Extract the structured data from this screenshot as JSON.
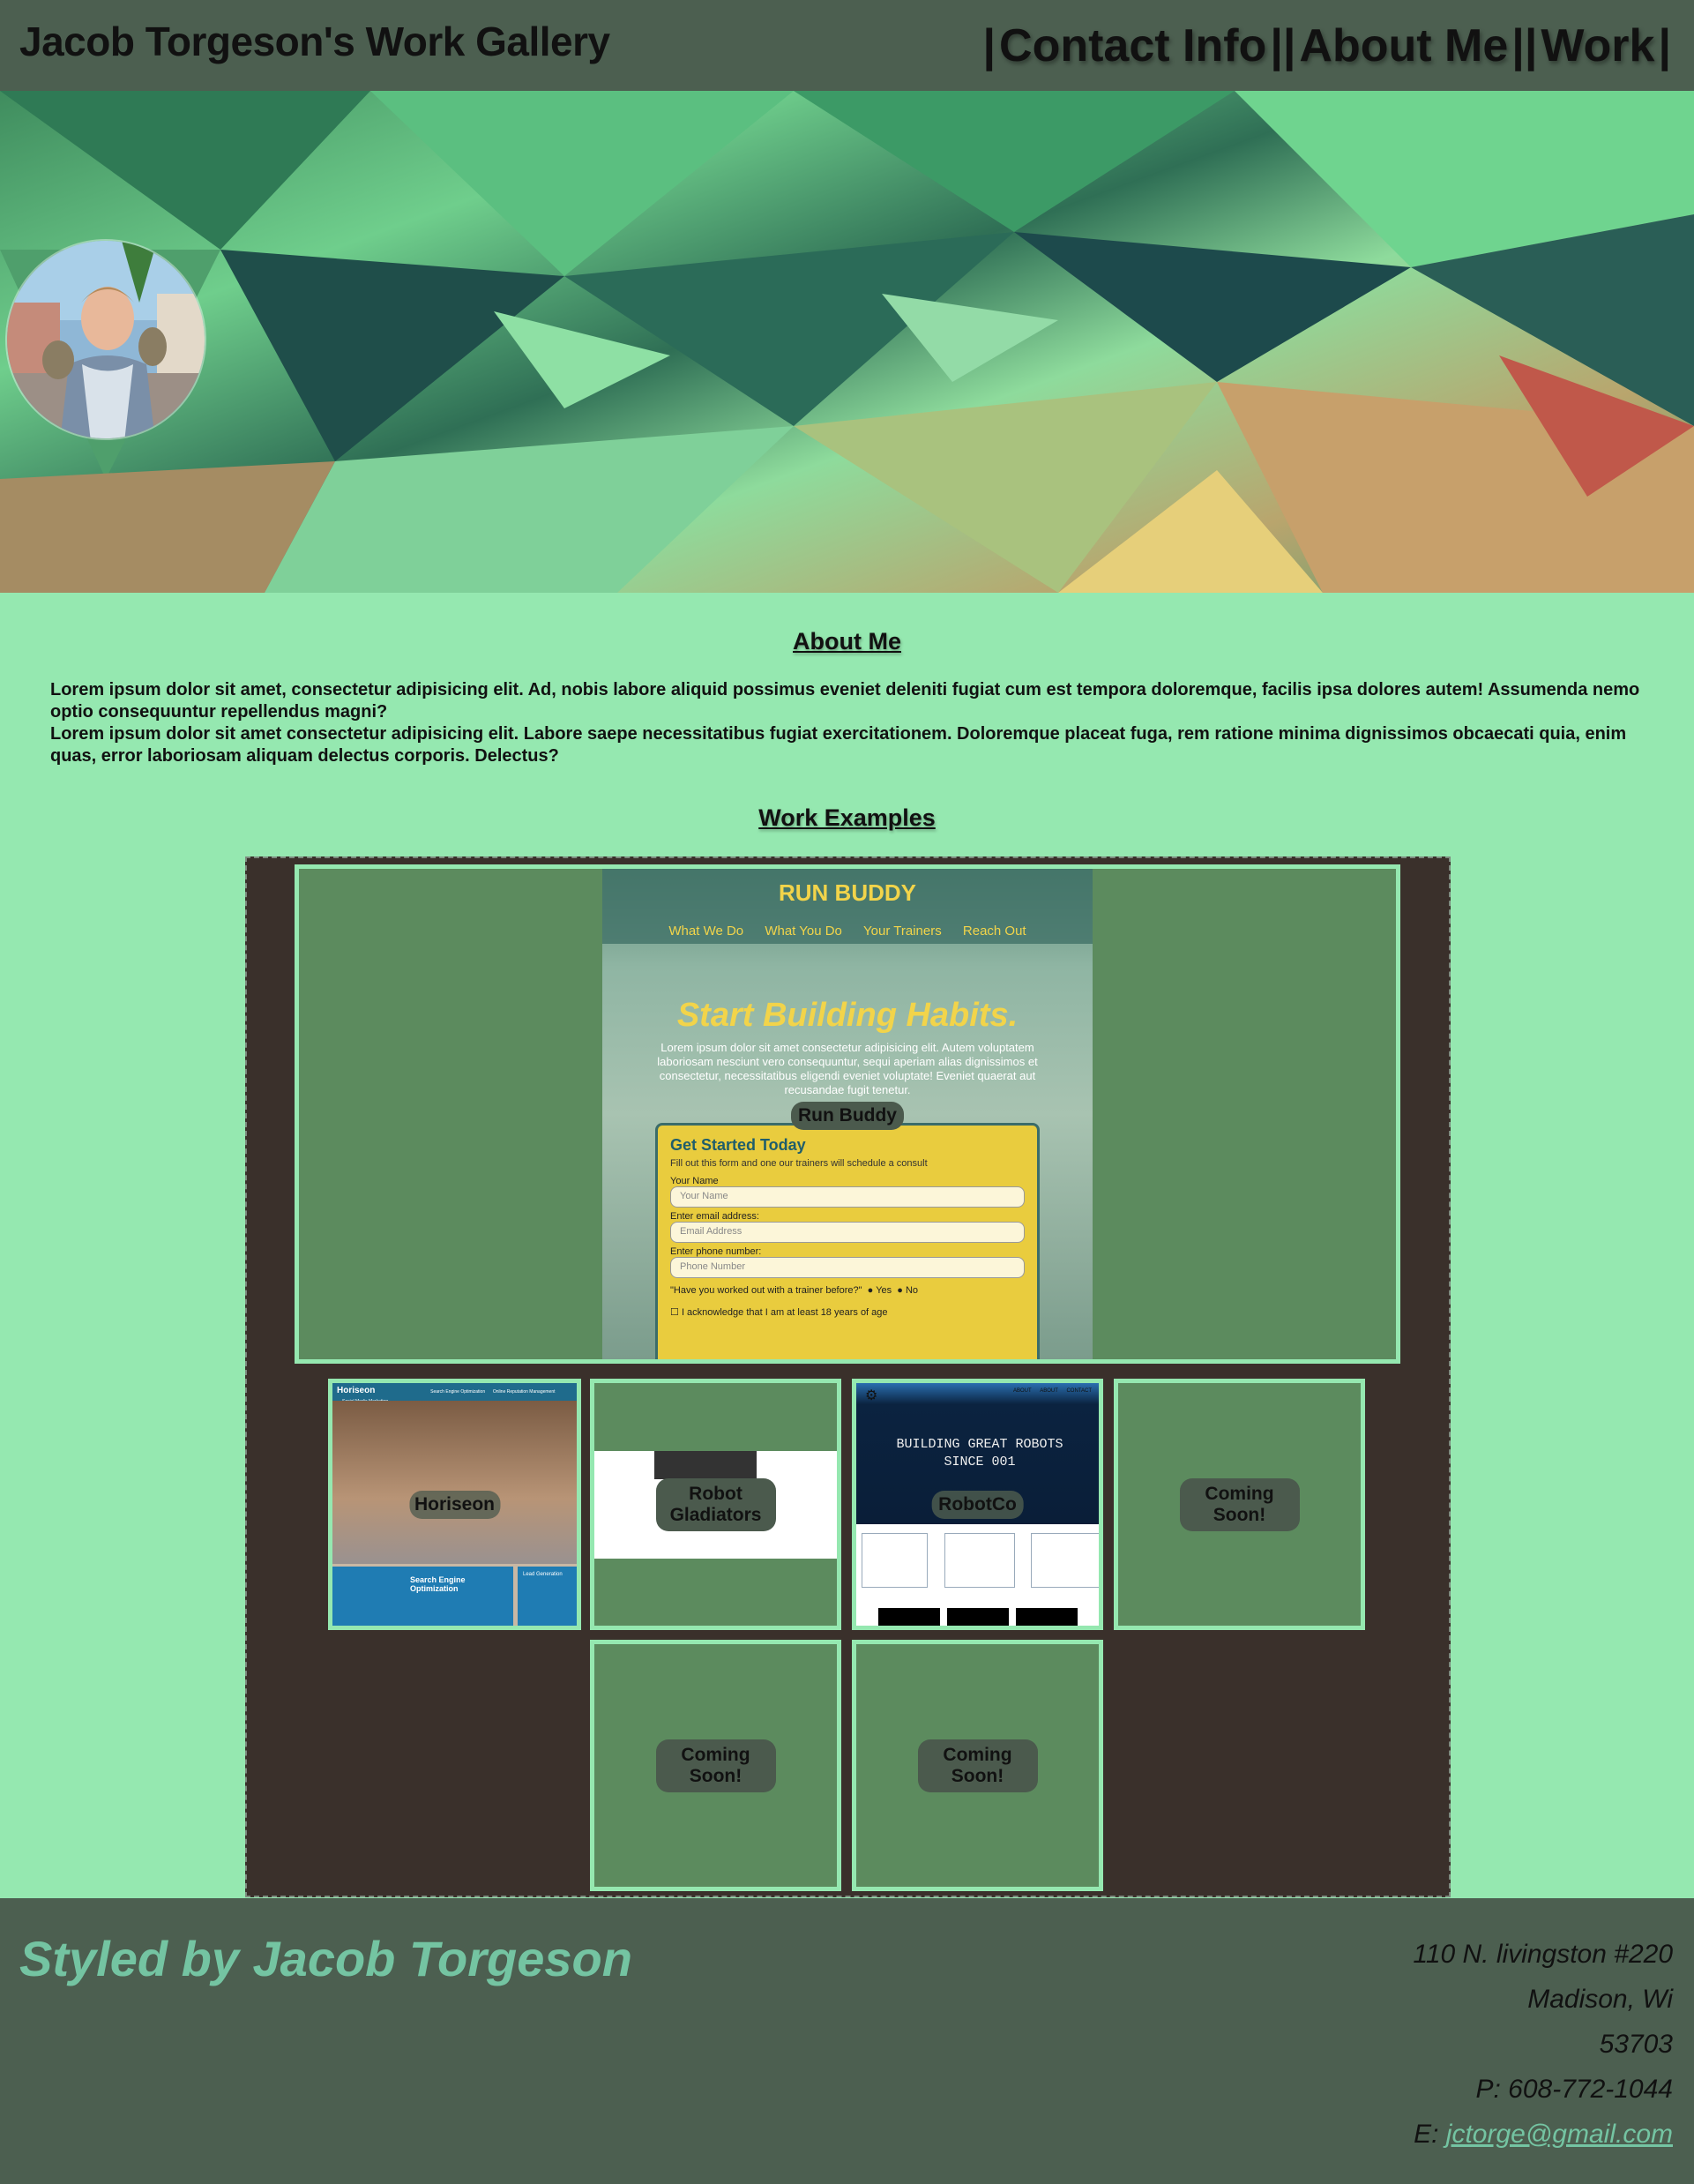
{
  "header": {
    "title": "Jacob Torgeson's Work Gallery",
    "nav": [
      {
        "label": "Contact Info"
      },
      {
        "label": "About Me"
      },
      {
        "label": "Work"
      }
    ],
    "separator": "|",
    "double_separator": "||"
  },
  "about": {
    "heading": "About Me",
    "paragraphs": [
      "Lorem ipsum dolor sit amet, consectetur adipisicing elit. Ad, nobis labore aliquid possimus eveniet deleniti fugiat cum est tempora doloremque, facilis ipsa dolores autem! Assumenda nemo optio consequuntur repellendus magni?",
      "Lorem ipsum dolor sit amet consectetur adipisicing elit. Labore saepe necessitatibus fugiat exercitationem. Doloremque placeat fuga, rem ratione minima dignissimos obcaecati quia, enim quas, error laboriosam aliquam delectus corporis. Delectus?"
    ]
  },
  "work": {
    "heading": "Work Examples",
    "featured": {
      "label": "Run Buddy",
      "screenshot": {
        "title": "RUN BUDDY",
        "nav": [
          "What We Do",
          "What You Do",
          "Your Trainers",
          "Reach Out"
        ],
        "hero_title": "Start Building Habits.",
        "hero_text": "Lorem ipsum dolor sit amet consectetur adipisicing elit. Autem voluptatem laboriosam nesciunt vero consequuntur, sequi aperiam alias dignissimos et consectetur, necessitatibus eligendi eveniet voluptate! Eveniet quaerat aut recusandae fugit tenetur.",
        "form_title": "Get Started Today",
        "form_subtitle": "Fill out this form and one our trainers will schedule a consult",
        "fields": [
          {
            "label": "Your Name",
            "placeholder": "Your Name"
          },
          {
            "label": "Enter email address:",
            "placeholder": "Email Address"
          },
          {
            "label": "Enter phone number:",
            "placeholder": "Phone Number"
          }
        ],
        "question": "\"Have you worked out with a trainer before?\"",
        "yes": "Yes",
        "no": "No",
        "checkbox": "I acknowledge that I am at least 18 years of age"
      }
    },
    "cards": [
      {
        "label": "Horiseon",
        "screenshot": {
          "brand": "Horiseon",
          "links": [
            "Search Engine Optimization",
            "Online Reputation Management",
            "Social Media Marketing"
          ],
          "section": "Search Engine Optimization",
          "aside": "Lead Generation"
        }
      },
      {
        "label": "Robot Gladiators"
      },
      {
        "label": "RobotCo",
        "screenshot": {
          "headline": "BUILDING GREAT ROBOTS SINCE 001",
          "nav": [
            "ABOUT",
            "ABOUT",
            "CONTACT"
          ]
        }
      },
      {
        "label": "Coming Soon!"
      },
      {
        "label": "Coming Soon!"
      },
      {
        "label": "Coming Soon!"
      }
    ]
  },
  "footer": {
    "styled_by": "Styled by Jacob Torgeson",
    "address_lines": [
      "110 N. livingston #220",
      "Madison, Wi",
      "53703",
      "P: 608-772-1044"
    ],
    "email_prefix": "E: ",
    "email": "jctorge@gmail.com"
  },
  "colors": {
    "header_bg": "#4c5f50",
    "page_bg": "#95e8b0",
    "gallery_bg": "#3a302b",
    "card_bg": "#5c8b5e",
    "accent": "#74c4a2"
  }
}
